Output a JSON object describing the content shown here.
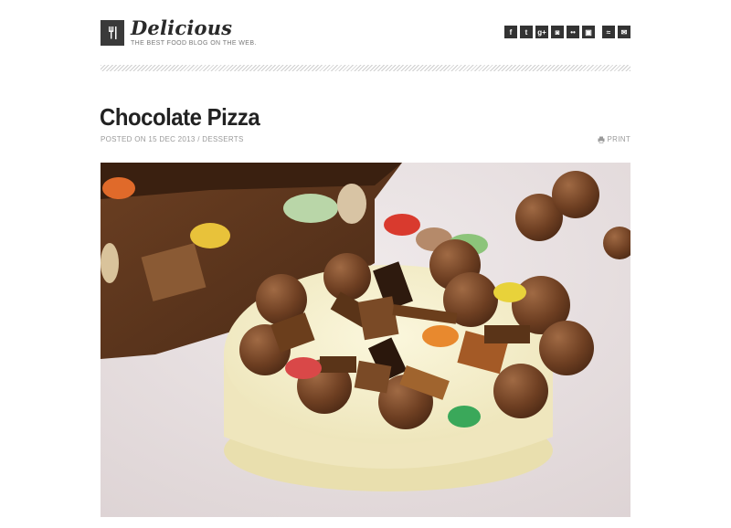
{
  "header": {
    "brand": "Delicious",
    "tagline": "THE BEST FOOD BLOG ON THE WEB.",
    "logo_icon": "fork-knife-icon"
  },
  "social": [
    {
      "name": "facebook-icon",
      "glyph": "f"
    },
    {
      "name": "twitter-icon",
      "glyph": "t"
    },
    {
      "name": "google-plus-icon",
      "glyph": "g+"
    },
    {
      "name": "instagram-icon",
      "glyph": "◙"
    },
    {
      "name": "flickr-icon",
      "glyph": "••"
    },
    {
      "name": "pinterest-icon",
      "glyph": "▣"
    },
    {
      "name": "rss-icon",
      "glyph": "≈"
    },
    {
      "name": "email-icon",
      "glyph": "✉"
    }
  ],
  "post": {
    "title": "Chocolate Pizza",
    "meta": "POSTED ON 15 DEC 2013 / DESSERTS",
    "print_label": "PRINT"
  },
  "colors": {
    "accent": "#333333",
    "text": "#222222",
    "muted": "#9a9a9a"
  }
}
